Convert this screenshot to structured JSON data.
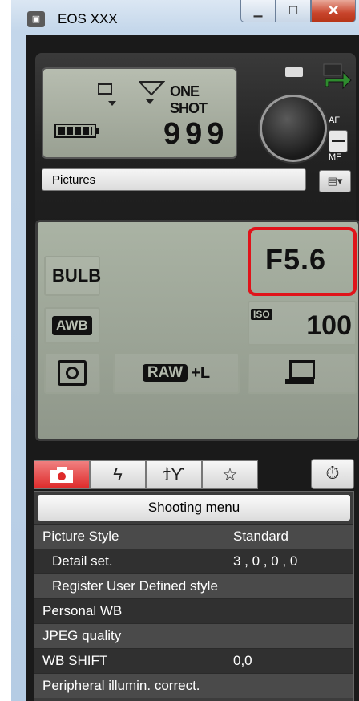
{
  "window": {
    "title": "EOS XXX",
    "app_icon": "camera-icon"
  },
  "status": {
    "af_mode": "ONE SHOT",
    "shots_remaining": "999",
    "af_label": "AF",
    "mf_label": "MF",
    "folder": "Pictures"
  },
  "settings": {
    "shutter": "BULB",
    "white_balance": "AWB",
    "aperture": "F5.6",
    "iso_label": "ISO",
    "iso": "100",
    "quality_raw": "RAW",
    "quality_plus": "+L"
  },
  "tabs": [
    {
      "icon": "camera-icon",
      "active": true
    },
    {
      "icon": "flash-icon",
      "glyph": "ϟ"
    },
    {
      "icon": "tools-icon",
      "glyph": "ϯϒ"
    },
    {
      "icon": "star-icon",
      "glyph": "☆"
    }
  ],
  "timer_icon": "⏱",
  "menu": {
    "title": "Shooting menu",
    "rows": [
      {
        "label": "Picture Style",
        "value": "Standard"
      },
      {
        "label": "Detail set.",
        "value": "3 , 0 , 0 , 0"
      },
      {
        "label": "Register User Defined style",
        "value": ""
      },
      {
        "label": "Personal WB",
        "value": ""
      },
      {
        "label": "JPEG quality",
        "value": ""
      },
      {
        "label": "WB SHIFT",
        "value": "0,0"
      },
      {
        "label": "Peripheral illumin. correct.",
        "value": ""
      }
    ]
  }
}
